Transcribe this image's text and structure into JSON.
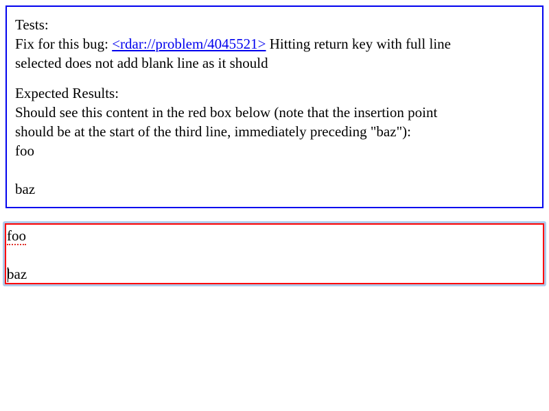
{
  "explanation": {
    "tests_heading": "Tests:",
    "fix_prefix": "Fix for this bug: ",
    "bug_link": "<rdar://problem/4045521>",
    "fix_suffix": " Hitting return key with full line",
    "fix_line2": "selected does not add blank line as it should",
    "expected_heading": "Expected Results:",
    "expected_line1": "Should see this content in the red box below (note that the insertion point",
    "expected_line2": "should be at the start of the third line, immediately preceding \"baz\"):",
    "sample_line1": "foo",
    "sample_line3": "baz"
  },
  "editor": {
    "line1": "foo",
    "line3": "baz"
  },
  "colors": {
    "explanation_border": "#0000ee",
    "editor_border": "#ff0000",
    "focus_ring": "#aecbeb",
    "link": "#0000ee",
    "spell_underline": "#e0302a"
  }
}
